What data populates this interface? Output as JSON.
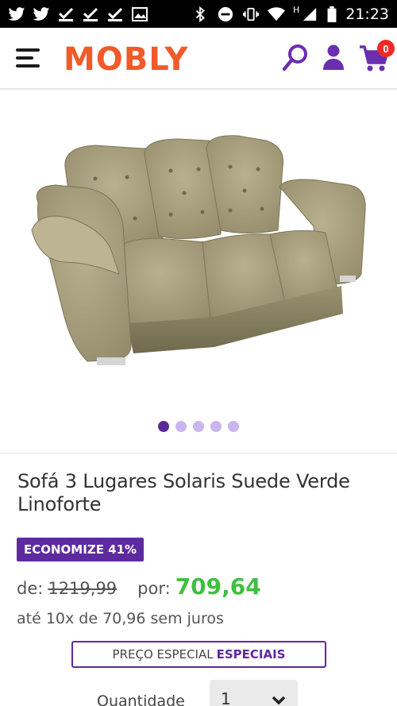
{
  "status_bar": {
    "time": "21:23",
    "network_label": "H"
  },
  "header": {
    "logo_text": "MOBLY",
    "cart_count": "0"
  },
  "gallery": {
    "image_alt": "Sofá 3 Lugares Solaris Suede Verde Linoforte",
    "slide_count": 5,
    "active_slide": 0
  },
  "product": {
    "title": "Sofá 3 Lugares Solaris Suede Verde Linoforte",
    "discount_badge": "ECONOMIZE 41%",
    "price_from_label": "de:",
    "price_old": "1219,99",
    "price_for_label": "por:",
    "price_new": "709,64",
    "installments": "até 10x de 70,96 sem juros",
    "special_price_label": "PREÇO ESPECIAL",
    "special_price_link": "ESPECIAIS"
  },
  "quantity": {
    "label": "Quantidade",
    "value": "1"
  },
  "colors": {
    "brand_orange": "#f15a29",
    "brand_purple": "#5e2aa0",
    "price_green": "#3fbf3f",
    "badge_red": "#ee2a26"
  }
}
